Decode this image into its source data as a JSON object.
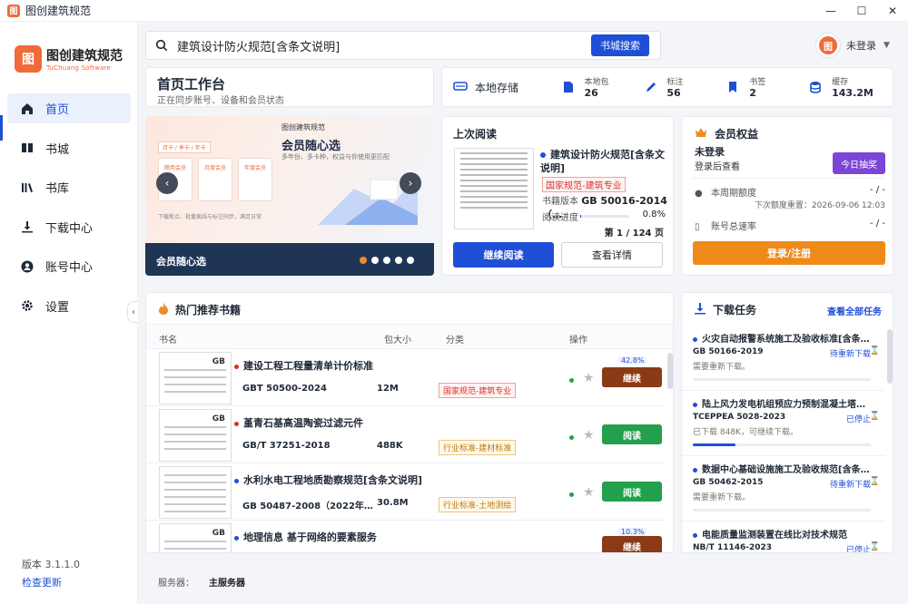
{
  "window": {
    "title": "图创建筑规范",
    "min": "—",
    "max": "☐",
    "close": "✕"
  },
  "sidebar": {
    "logo_name": "图创建筑规范",
    "logo_sub": "TuChuang Software",
    "items": [
      {
        "label": "首页",
        "icon": "home-icon"
      },
      {
        "label": "书城",
        "icon": "book-icon"
      },
      {
        "label": "书库",
        "icon": "library-icon"
      },
      {
        "label": "下载中心",
        "icon": "download-icon"
      },
      {
        "label": "账号中心",
        "icon": "account-icon"
      },
      {
        "label": "设置",
        "icon": "gear-icon"
      }
    ],
    "version": "版本 3.1.1.0",
    "update": "检查更新"
  },
  "search": {
    "query": "建筑设计防火规范[含条文说明]",
    "button": "书城搜索"
  },
  "user": {
    "name": "未登录",
    "avatar_text": "图"
  },
  "workbench": {
    "title": "首页工作台",
    "subtitle": "正在同步账号、设备和会员状态"
  },
  "storage": {
    "label": "本地存储",
    "stats": [
      {
        "label": "本地包",
        "value": "26"
      },
      {
        "label": "标注",
        "value": "56"
      },
      {
        "label": "书签",
        "value": "2"
      },
      {
        "label": "缓存",
        "value": "143.2M"
      }
    ]
  },
  "banner": {
    "brand": "图创建筑规范",
    "title": "会员随心选",
    "subtitle": "多年份、多卡种，权益与你使用更匹配",
    "tag": "月卡 / 季卡 / 年卡",
    "cards": [
      "随用会员",
      "月度会员",
      "年度会员"
    ],
    "caption": "下载断点、批量离线与标注同步，满足日常",
    "footer": "会员随心选"
  },
  "last_read": {
    "title": "上次阅读",
    "book": "建筑设计防火规范[含条文说明]",
    "tag": "国家规范-建筑专业",
    "version_label": "书籍版本",
    "version": "GB 50016-2014（…",
    "progress_label": "阅读进度",
    "progress": "0.8%",
    "page": "第 1 / 124 页",
    "continue": "继续阅读",
    "detail": "查看详情"
  },
  "membership": {
    "title": "会员权益",
    "status": "未登录",
    "hint": "登录后查看",
    "draw": "今日抽奖",
    "quota_label": "本周期额度",
    "quota_value": "- / -",
    "reset": "下次额度重置：2026-09-06 12:03",
    "speed_label": "账号总速率",
    "speed_value": "- / -",
    "login": "登录/注册"
  },
  "hot": {
    "title": "热门推荐书籍",
    "columns": [
      "书名",
      "包大小",
      "分类",
      "操作"
    ],
    "rows": [
      {
        "name": "建设工程工程量清单计价标准",
        "code": "GBT 50500-2024",
        "size": "12M",
        "category": "国家规范-建筑专业",
        "action": "继续",
        "pct": "42.8%",
        "cover_mark": "GB"
      },
      {
        "name": "堇青石基高温陶瓷过滤元件",
        "code": "GB/T 37251-2018",
        "size": "488K",
        "category": "行业标准-建材标准",
        "action": "阅读",
        "pct": "",
        "cover_mark": "GB"
      },
      {
        "name": "水利水电工程地质勘察规范[含条文说明]",
        "code": "GB 50487-2008（2022年…",
        "size": "30.8M",
        "category": "行业标准-土地测绘",
        "action": "阅读",
        "pct": "",
        "cover_mark": ""
      },
      {
        "name": "地理信息 基于网络的要素服务",
        "code": "",
        "size": "",
        "category": "",
        "action": "继续",
        "pct": "10.3%",
        "cover_mark": "GB"
      }
    ]
  },
  "downloads": {
    "title": "下载任务",
    "all": "查看全部任务",
    "items": [
      {
        "title": "火灾自动报警系统施工及验收标准[含条…",
        "code": "GB 50166-2019",
        "status": "待重新下载",
        "note": "需要重新下载。",
        "progress": 0
      },
      {
        "title": "陆上风力发电机组预应力预制混凝土塔…",
        "code": "TCEPPEA 5028-2023",
        "status": "已停止",
        "note": "已下载 848K，可继续下载。",
        "progress": 0.24
      },
      {
        "title": "数据中心基础设施施工及验收规范[含条…",
        "code": "GB 50462-2015",
        "status": "待重新下载",
        "note": "需要重新下载。",
        "progress": 0
      },
      {
        "title": "电能质量监测装置在线比对技术规范",
        "code": "NB/T 11146-2023",
        "status": "已停止",
        "note": "",
        "progress": 0
      }
    ]
  },
  "footer": {
    "label": "服务器：",
    "value": "主服务器"
  },
  "colors": {
    "accent": "#1f4fd6",
    "brand": "#ef6b3a",
    "continue_btn": "#8b3a16",
    "read_btn": "#22a04b",
    "draw": "#7b45d6",
    "login": "#ef8a1a"
  }
}
